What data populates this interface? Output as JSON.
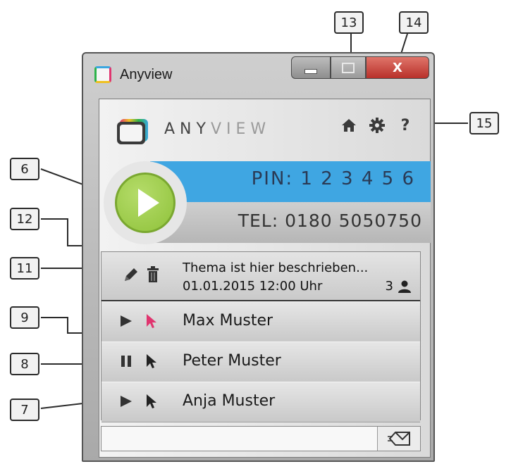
{
  "window": {
    "title": "Anyview",
    "buttons": {
      "minimize": "minimize",
      "maximize": "maximize",
      "close": "X"
    }
  },
  "brand": {
    "part1": "ANY",
    "part2": "VIEW"
  },
  "header_icons": [
    "home-icon",
    "gear-icon",
    "help-icon"
  ],
  "help_label": "?",
  "pin": {
    "label": "PIN:",
    "digits": "1 2 3 4 5 6"
  },
  "tel": {
    "label": "TEL:",
    "number": "0180 5050750"
  },
  "topic": {
    "title": "Thema ist hier beschrieben...",
    "datetime": "01.01.2015 12:00 Uhr",
    "participant_count": "3"
  },
  "participants": [
    {
      "name": "Max Muster",
      "state": "play",
      "cursor_color": "#e0356f"
    },
    {
      "name": "Peter Muster",
      "state": "pause",
      "cursor_color": "#222222"
    },
    {
      "name": "Anja Muster",
      "state": "play",
      "cursor_color": "#222222"
    }
  ],
  "message": {
    "value": "",
    "placeholder": ""
  },
  "callouts": [
    "6",
    "7",
    "8",
    "9",
    "11",
    "12",
    "13",
    "14",
    "15"
  ],
  "colors": {
    "pin_band": "#3fa6e2",
    "play_button": "#8fc23a",
    "active_cursor": "#e0356f"
  }
}
